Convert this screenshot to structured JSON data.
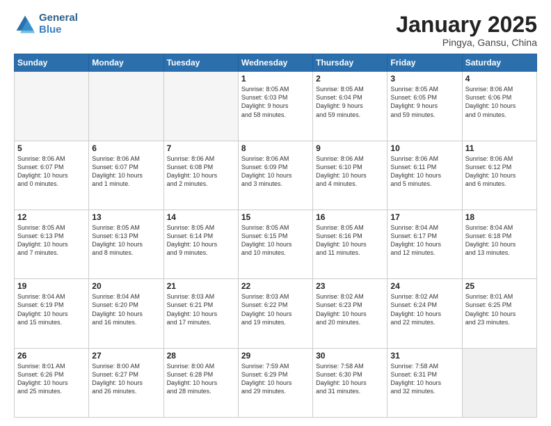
{
  "header": {
    "logo_line1": "General",
    "logo_line2": "Blue",
    "month_title": "January 2025",
    "location": "Pingya, Gansu, China"
  },
  "weekdays": [
    "Sunday",
    "Monday",
    "Tuesday",
    "Wednesday",
    "Thursday",
    "Friday",
    "Saturday"
  ],
  "weeks": [
    [
      {
        "day": "",
        "info": ""
      },
      {
        "day": "",
        "info": ""
      },
      {
        "day": "",
        "info": ""
      },
      {
        "day": "1",
        "info": "Sunrise: 8:05 AM\nSunset: 6:03 PM\nDaylight: 9 hours\nand 58 minutes."
      },
      {
        "day": "2",
        "info": "Sunrise: 8:05 AM\nSunset: 6:04 PM\nDaylight: 9 hours\nand 59 minutes."
      },
      {
        "day": "3",
        "info": "Sunrise: 8:05 AM\nSunset: 6:05 PM\nDaylight: 9 hours\nand 59 minutes."
      },
      {
        "day": "4",
        "info": "Sunrise: 8:06 AM\nSunset: 6:06 PM\nDaylight: 10 hours\nand 0 minutes."
      }
    ],
    [
      {
        "day": "5",
        "info": "Sunrise: 8:06 AM\nSunset: 6:07 PM\nDaylight: 10 hours\nand 0 minutes."
      },
      {
        "day": "6",
        "info": "Sunrise: 8:06 AM\nSunset: 6:07 PM\nDaylight: 10 hours\nand 1 minute."
      },
      {
        "day": "7",
        "info": "Sunrise: 8:06 AM\nSunset: 6:08 PM\nDaylight: 10 hours\nand 2 minutes."
      },
      {
        "day": "8",
        "info": "Sunrise: 8:06 AM\nSunset: 6:09 PM\nDaylight: 10 hours\nand 3 minutes."
      },
      {
        "day": "9",
        "info": "Sunrise: 8:06 AM\nSunset: 6:10 PM\nDaylight: 10 hours\nand 4 minutes."
      },
      {
        "day": "10",
        "info": "Sunrise: 8:06 AM\nSunset: 6:11 PM\nDaylight: 10 hours\nand 5 minutes."
      },
      {
        "day": "11",
        "info": "Sunrise: 8:06 AM\nSunset: 6:12 PM\nDaylight: 10 hours\nand 6 minutes."
      }
    ],
    [
      {
        "day": "12",
        "info": "Sunrise: 8:05 AM\nSunset: 6:13 PM\nDaylight: 10 hours\nand 7 minutes."
      },
      {
        "day": "13",
        "info": "Sunrise: 8:05 AM\nSunset: 6:13 PM\nDaylight: 10 hours\nand 8 minutes."
      },
      {
        "day": "14",
        "info": "Sunrise: 8:05 AM\nSunset: 6:14 PM\nDaylight: 10 hours\nand 9 minutes."
      },
      {
        "day": "15",
        "info": "Sunrise: 8:05 AM\nSunset: 6:15 PM\nDaylight: 10 hours\nand 10 minutes."
      },
      {
        "day": "16",
        "info": "Sunrise: 8:05 AM\nSunset: 6:16 PM\nDaylight: 10 hours\nand 11 minutes."
      },
      {
        "day": "17",
        "info": "Sunrise: 8:04 AM\nSunset: 6:17 PM\nDaylight: 10 hours\nand 12 minutes."
      },
      {
        "day": "18",
        "info": "Sunrise: 8:04 AM\nSunset: 6:18 PM\nDaylight: 10 hours\nand 13 minutes."
      }
    ],
    [
      {
        "day": "19",
        "info": "Sunrise: 8:04 AM\nSunset: 6:19 PM\nDaylight: 10 hours\nand 15 minutes."
      },
      {
        "day": "20",
        "info": "Sunrise: 8:04 AM\nSunset: 6:20 PM\nDaylight: 10 hours\nand 16 minutes."
      },
      {
        "day": "21",
        "info": "Sunrise: 8:03 AM\nSunset: 6:21 PM\nDaylight: 10 hours\nand 17 minutes."
      },
      {
        "day": "22",
        "info": "Sunrise: 8:03 AM\nSunset: 6:22 PM\nDaylight: 10 hours\nand 19 minutes."
      },
      {
        "day": "23",
        "info": "Sunrise: 8:02 AM\nSunset: 6:23 PM\nDaylight: 10 hours\nand 20 minutes."
      },
      {
        "day": "24",
        "info": "Sunrise: 8:02 AM\nSunset: 6:24 PM\nDaylight: 10 hours\nand 22 minutes."
      },
      {
        "day": "25",
        "info": "Sunrise: 8:01 AM\nSunset: 6:25 PM\nDaylight: 10 hours\nand 23 minutes."
      }
    ],
    [
      {
        "day": "26",
        "info": "Sunrise: 8:01 AM\nSunset: 6:26 PM\nDaylight: 10 hours\nand 25 minutes."
      },
      {
        "day": "27",
        "info": "Sunrise: 8:00 AM\nSunset: 6:27 PM\nDaylight: 10 hours\nand 26 minutes."
      },
      {
        "day": "28",
        "info": "Sunrise: 8:00 AM\nSunset: 6:28 PM\nDaylight: 10 hours\nand 28 minutes."
      },
      {
        "day": "29",
        "info": "Sunrise: 7:59 AM\nSunset: 6:29 PM\nDaylight: 10 hours\nand 29 minutes."
      },
      {
        "day": "30",
        "info": "Sunrise: 7:58 AM\nSunset: 6:30 PM\nDaylight: 10 hours\nand 31 minutes."
      },
      {
        "day": "31",
        "info": "Sunrise: 7:58 AM\nSunset: 6:31 PM\nDaylight: 10 hours\nand 32 minutes."
      },
      {
        "day": "",
        "info": ""
      }
    ]
  ]
}
